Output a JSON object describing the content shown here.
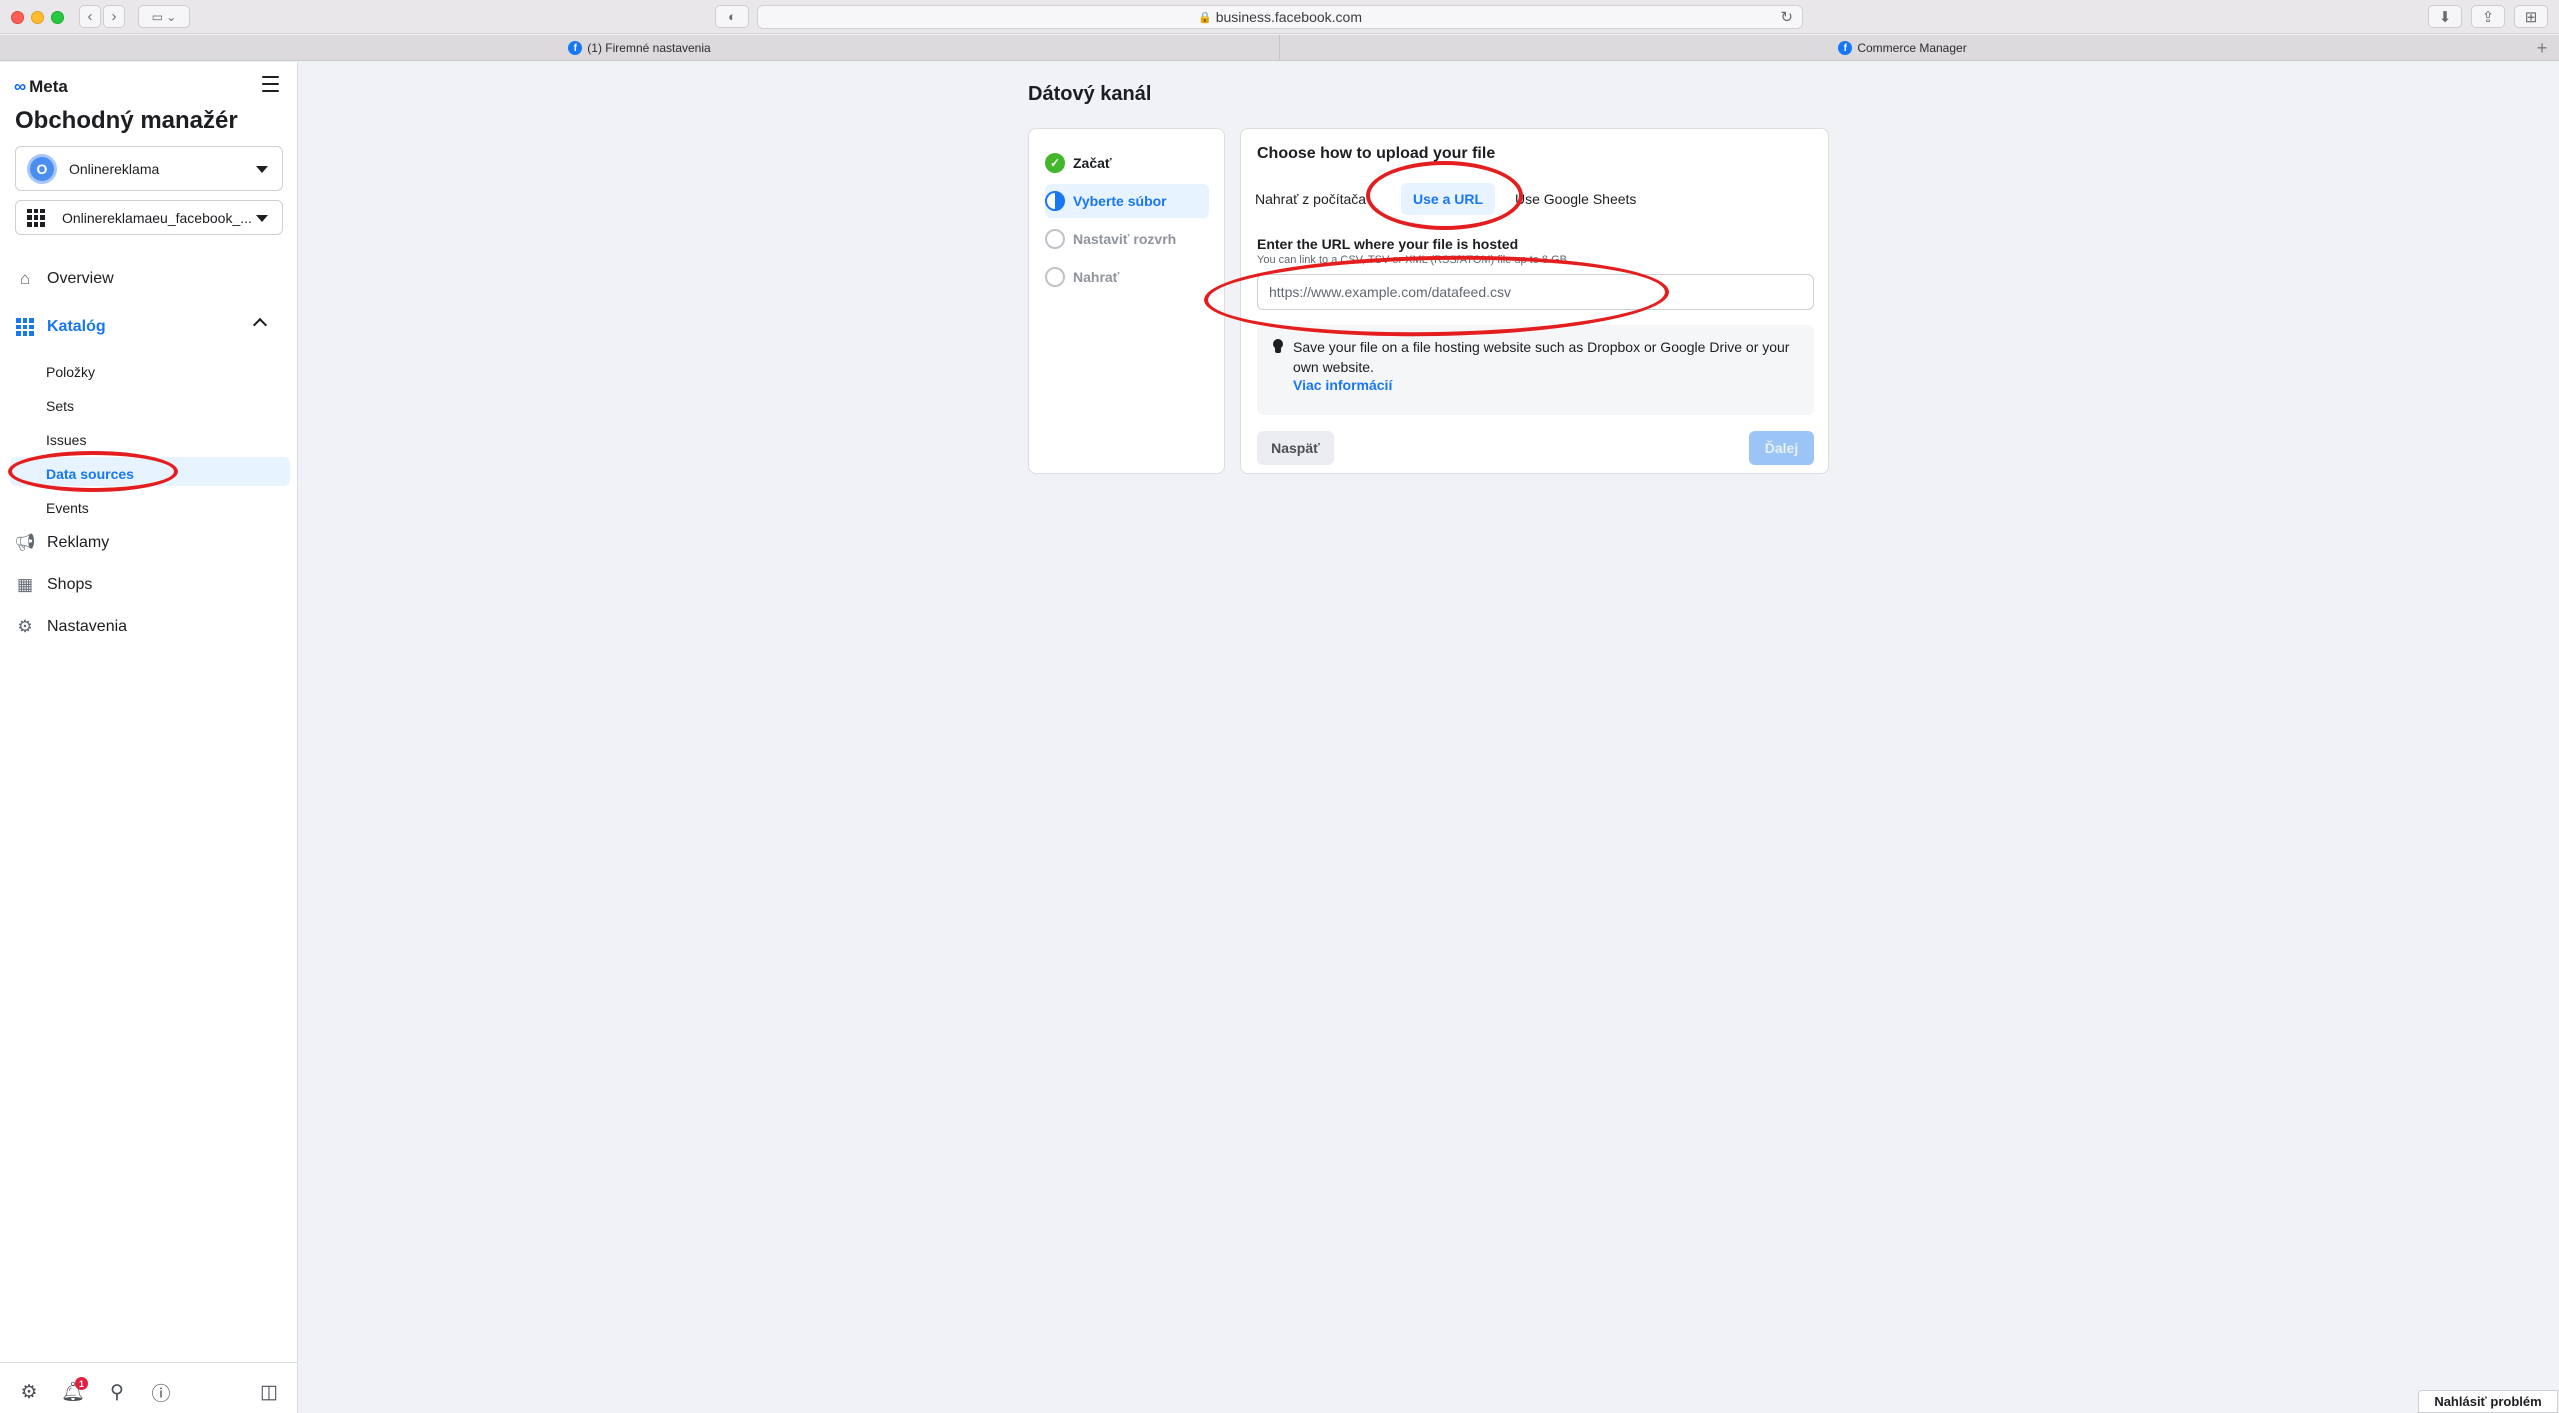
{
  "browser": {
    "url": "business.facebook.com",
    "tabs": [
      {
        "label": "(1) Firemné nastavenia"
      },
      {
        "label": "Commerce Manager"
      }
    ],
    "new_tab": "+"
  },
  "sidebar": {
    "logo": "Meta",
    "app_title": "Obchodný manažér",
    "business_selector": {
      "initial": "O",
      "value": "Onlinereklama"
    },
    "catalog_selector": {
      "value": "Onlinereklamaeu_facebook_..."
    },
    "nav": [
      {
        "label": "Overview",
        "icon": "home-icon"
      },
      {
        "label": "Katalóg",
        "icon": "catalog-grid-icon",
        "active": true
      },
      {
        "label": "Reklamy",
        "icon": "megaphone-icon"
      },
      {
        "label": "Shops",
        "icon": "shop-icon"
      },
      {
        "label": "Nastavenia",
        "icon": "gear-icon"
      }
    ],
    "catalog_items": [
      {
        "label": "Položky"
      },
      {
        "label": "Sets"
      },
      {
        "label": "Issues"
      },
      {
        "label": "Data sources",
        "active": true
      },
      {
        "label": "Events"
      }
    ],
    "footer": {
      "notification_count": "1"
    }
  },
  "main": {
    "page_title": "Dátový kanál",
    "steps": [
      {
        "label": "Začať",
        "state": "done"
      },
      {
        "label": "Vyberte súbor",
        "state": "current"
      },
      {
        "label": "Nastaviť rozvrh",
        "state": "pending"
      },
      {
        "label": "Nahrať",
        "state": "pending"
      }
    ],
    "upload": {
      "title": "Choose how to upload your file",
      "options": [
        {
          "label": "Nahrať z počítača"
        },
        {
          "label": "Use a URL",
          "selected": true
        },
        {
          "label": "Use Google Sheets"
        }
      ],
      "field_label": "Enter the URL where your file is hosted",
      "field_help": "You can link to a CSV, TSV or XML (RSS/ATOM) file up to 8 GB.",
      "url_placeholder": "https://www.example.com/datafeed.csv",
      "url_value": "",
      "tip_text": "Save your file on a file hosting website such as Dropbox or Google Drive or your own website.",
      "tip_link": "Viac informácií",
      "back_button": "Naspäť",
      "next_button": "Ďalej"
    },
    "report_button": "Nahlásiť problém"
  },
  "colors": {
    "accent": "#1877f2",
    "success": "#42b72a",
    "annotation": "#e41e1e",
    "background": "#f0f2f5"
  }
}
